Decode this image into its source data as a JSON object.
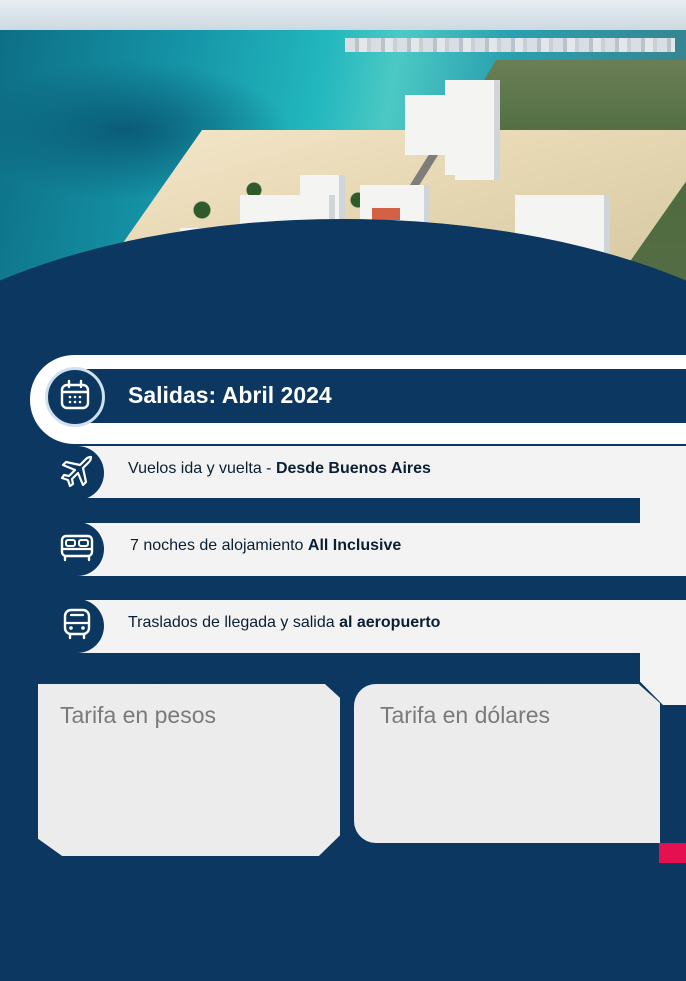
{
  "colors": {
    "navy": "#0b3761",
    "light_bar": "#f3f3f3",
    "card": "#ececec",
    "accent": "#e4104f"
  },
  "hero": {
    "image": "aerial-cancun-hotel-zone-photo"
  },
  "rows": [
    {
      "icon": "calendar-icon",
      "text": "Salidas: Abril 2024"
    },
    {
      "icon": "airplane-icon",
      "text_regular": "Vuelos ida y vuelta - ",
      "text_bold": "Desde Buenos Aires"
    },
    {
      "icon": "bed-icon",
      "text_regular": "7 noches de alojamiento ",
      "text_bold": "All Inclusive"
    },
    {
      "icon": "bus-icon",
      "text_regular": "Traslados de llegada y salida ",
      "text_bold": "al aeropuerto"
    }
  ],
  "cards": {
    "pesos_label": "Tarifa en pesos",
    "dolares_label": "Tarifa en dólares"
  }
}
